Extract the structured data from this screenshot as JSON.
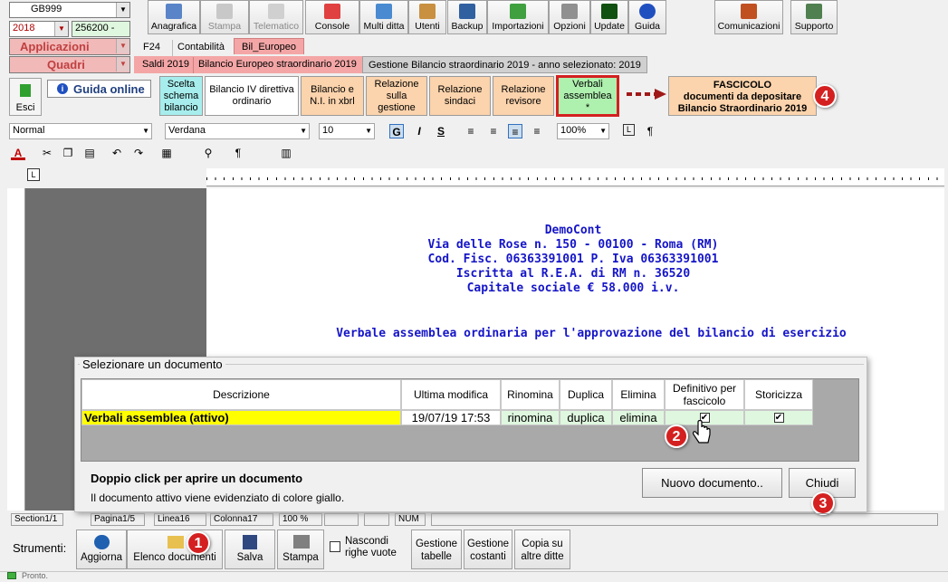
{
  "top_controls": {
    "company": "GB999",
    "year": "2018",
    "code": "256200 -",
    "applicazioni": "Applicazioni",
    "quadri": "Quadri"
  },
  "toolbar": {
    "anagrafica": "Anagrafica",
    "stampa": "Stampa",
    "telematico": "Telematico",
    "console": "Console",
    "multi_ditta": "Multi ditta",
    "utenti": "Utenti",
    "backup": "Backup",
    "importazioni": "Importazioni",
    "opzioni": "Opzioni",
    "update": "Update",
    "guida": "Guida",
    "comunicazioni": "Comunicazioni",
    "supporto": "Supporto"
  },
  "tabs_row1": {
    "f24": "F24",
    "contabilita": "Contabilità",
    "bil_europeo": "Bil_Europeo"
  },
  "tabs_row2": {
    "saldi": "Saldi 2019",
    "bilancio_straord": "Bilancio Europeo straordinario 2019",
    "gestione": "Gestione Bilancio straordinario 2019 - anno selezionato: 2019"
  },
  "workflow": {
    "esci": "Esci",
    "guida_online": "Guida online",
    "scelta": "Scelta schema bilancio",
    "bilancio_iv": "Bilancio IV direttiva ordinario",
    "bilancio_xbrl": "Bilancio e N.I. in xbrl",
    "relazione_gestione": "Relazione sulla gestione",
    "relazione_sindaci": "Relazione sindaci",
    "relazione_revisore": "Relazione revisore",
    "verbali": "Verbali assemblea *",
    "fascicolo_title": "FASCICOLO",
    "fascicolo_line2": "documenti da depositare",
    "fascicolo_line3": "Bilancio Straordinario 2019"
  },
  "format": {
    "style": "Normal",
    "font": "Verdana",
    "size": "10",
    "bold": "G",
    "italic": "I",
    "strike": "S",
    "zoom": "100%",
    "para": "¶"
  },
  "document": {
    "line1": "DemoCont",
    "line2": "Via delle Rose n. 150 - 00100 - Roma (RM)",
    "line3": "Cod. Fisc. 06363391001 P. Iva 06363391001",
    "line4": "Iscritta al R.E.A. di RM n. 36520",
    "line5": "Capitale sociale € 58.000 i.v.",
    "title": "Verbale assemblea ordinaria per l'approvazione del bilancio di esercizio"
  },
  "dialog": {
    "legend": "Selezionare un documento",
    "headers": {
      "descrizione": "Descrizione",
      "ultima": "Ultima modifica",
      "rinomina": "Rinomina",
      "duplica": "Duplica",
      "elimina": "Elimina",
      "definitivo": "Definitivo per fascicolo",
      "storicizza": "Storicizza"
    },
    "row": {
      "descrizione": "Verbali assemblea (attivo)",
      "ultima": "19/07/19 17:53",
      "rinomina": "rinomina",
      "duplica": "duplica",
      "elimina": "elimina",
      "definitivo": "✔",
      "storicizza": "✔"
    },
    "hint1": "Doppio click per aprire un documento",
    "hint2": "Il documento attivo viene evidenziato di colore giallo.",
    "nuovo": "Nuovo documento..",
    "chiudi": "Chiudi"
  },
  "statusbar": {
    "section": "Section1/1",
    "pagina": "Pagina1/5",
    "linea": "Linea16",
    "colonna": "Colonna17",
    "zoom": "100 %",
    "num": "NUM"
  },
  "bottom": {
    "strumenti": "Strumenti:",
    "aggiorna": "Aggiorna",
    "elenco": "Elenco documenti",
    "salva": "Salva",
    "stampa": "Stampa",
    "nascondi": "Nascondi righe vuote",
    "gestione_tabelle": "Gestione tabelle",
    "gestione_costanti": "Gestione costanti",
    "copia": "Copia su altre ditte",
    "pronto": "Pronto."
  },
  "badges": {
    "b1": "1",
    "b2": "2",
    "b3": "3",
    "b4": "4"
  },
  "colors": {
    "accent_red": "#d42020",
    "highlight_yellow": "#ffff00",
    "doc_blue": "#1515c8",
    "pink": "#f4a6a6",
    "fascicolo": "#fbd3ac",
    "verbali_green": "#aef0ae"
  }
}
